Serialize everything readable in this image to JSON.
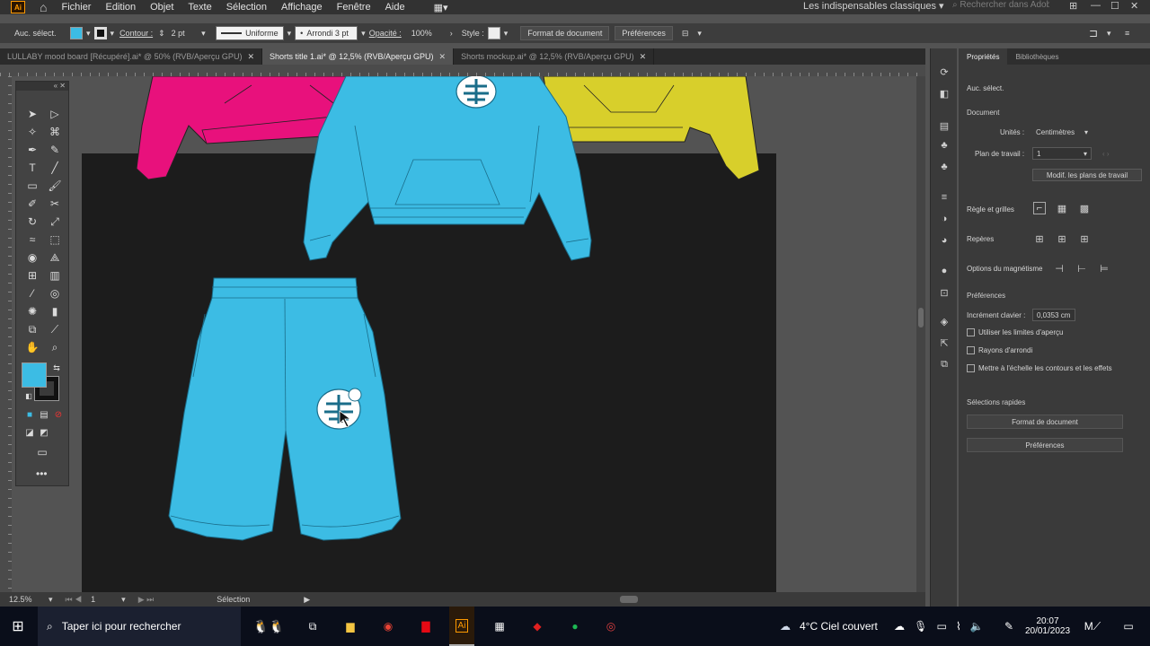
{
  "menubar": {
    "app_logo": "Ai",
    "items": [
      "Fichier",
      "Edition",
      "Objet",
      "Texte",
      "Sélection",
      "Affichage",
      "Fenêtre",
      "Aide"
    ],
    "workspace": "Les indispensables classiques",
    "search_placeholder": "Rechercher dans Adobe Stock"
  },
  "control_bar": {
    "no_selection": "Auc. sélect.",
    "stroke_label": "Contour :",
    "stroke_weight": "2 pt",
    "stroke_profile": "Uniforme",
    "brush": "Arrondi 3 pt",
    "opacity_label": "Opacité :",
    "opacity_value": "100%",
    "style_label": "Style :",
    "document_setup": "Format de document",
    "preferences": "Préférences"
  },
  "tabs": [
    {
      "label": "LULLABY mood board [Récupéré].ai* @ 50% (RVB/Aperçu GPU)",
      "active": false
    },
    {
      "label": "Shorts title 1.ai* @ 12,5% (RVB/Aperçu GPU)",
      "active": true
    },
    {
      "label": "Shorts mockup.ai* @ 12,5% (RVB/Aperçu GPU)",
      "active": false
    }
  ],
  "status": {
    "zoom": "12.5%",
    "artboard": "1",
    "tool": "Sélection"
  },
  "colors": {
    "pink": "#e8117c",
    "cyan": "#3cbce4",
    "yellow": "#d8cf2b",
    "artboard": "#1c1c1c",
    "outline": "#1a6d8a"
  },
  "properties": {
    "tabs": [
      "Propriétés",
      "Bibliothèques"
    ],
    "no_selection": "Auc. sélect.",
    "document": "Document",
    "units_label": "Unités :",
    "units_value": "Centimètres",
    "artboard_label": "Plan de travail :",
    "artboard_value": "1",
    "edit_artboards": "Modif. les plans de travail",
    "rulers_grids": "Règle et grilles",
    "guides": "Repères",
    "snap_options": "Options du magnétisme",
    "preferences": "Préférences",
    "keyboard_increment_label": "Incrément clavier :",
    "keyboard_increment_value": "0,0353 cm",
    "checks": [
      "Utiliser les limites d'aperçu",
      "Rayons d'arrondi",
      "Mettre à l'échelle les contours et les effets"
    ],
    "quick_actions": "Sélections rapides",
    "document_setup": "Format de document",
    "preferences_btn": "Préférences"
  },
  "taskbar": {
    "search_placeholder": "Taper ici pour rechercher",
    "weather": "4°C  Ciel couvert",
    "time": "20:07",
    "date": "20/01/2023"
  }
}
